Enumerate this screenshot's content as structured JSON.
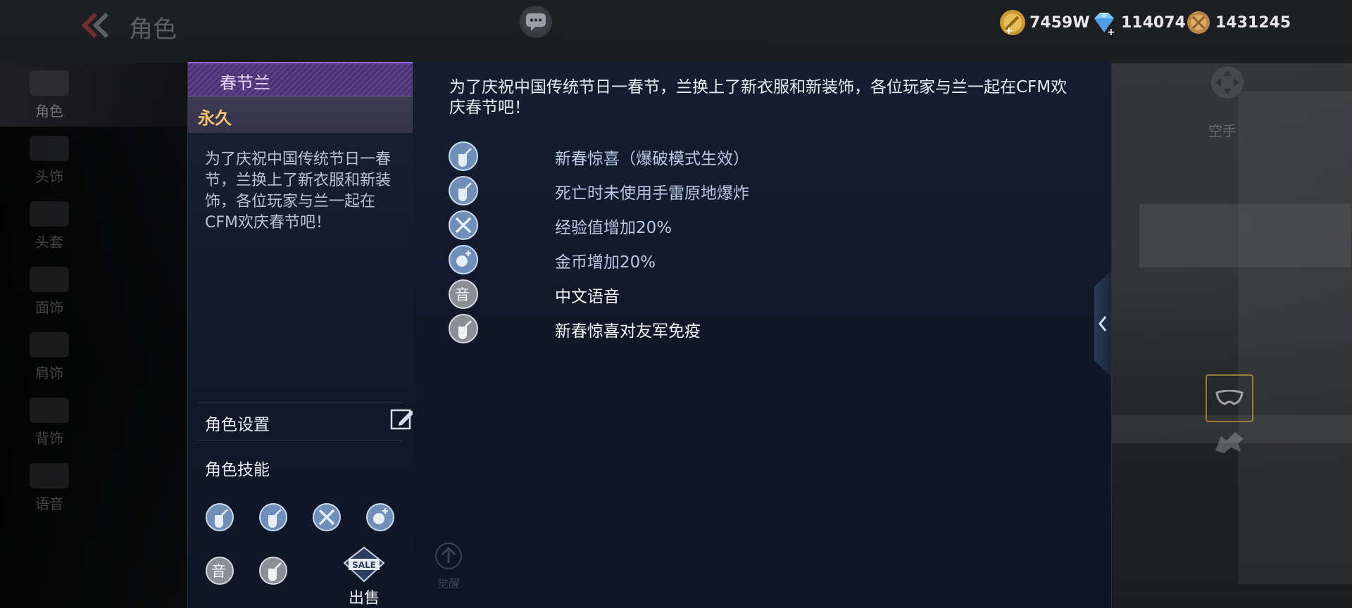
{
  "topbar": {
    "title": "角色",
    "currencies": [
      {
        "name": "gold",
        "value": "7459W",
        "color": "#e0b24a"
      },
      {
        "name": "diamond",
        "value": "114074",
        "color": "#7fc7ff"
      },
      {
        "name": "coin",
        "value": "1431245",
        "color": "#d4a857"
      }
    ]
  },
  "nav": {
    "items": [
      {
        "label": "角色",
        "active": true
      },
      {
        "label": "头饰"
      },
      {
        "label": "头套"
      },
      {
        "label": "面饰"
      },
      {
        "label": "肩饰"
      },
      {
        "label": "背饰"
      },
      {
        "label": "语音"
      }
    ]
  },
  "character": {
    "name": "春节兰",
    "duration": "永久",
    "description": "为了庆祝中国传统节日一春节，兰换上了新衣服和新装饰，各位玩家与兰一起在CFM欢庆春节吧！",
    "settings_label": "角色设置",
    "skills_label": "角色技能",
    "sell_badge": "SALE",
    "sell_label": "出售",
    "upgrade_label": "觉醒"
  },
  "detail": {
    "description": "为了庆祝中国传统节日一春节，兰换上了新衣服和新装饰，各位玩家与兰一起在CFM欢庆春节吧！",
    "attributes": [
      {
        "text": "新春惊喜（爆破模式生效）",
        "icon": "grenade-icon",
        "style": "blue"
      },
      {
        "text": "死亡时未使用手雷原地爆炸",
        "icon": "grenade-icon",
        "style": "blue"
      },
      {
        "text": "经验值增加20%",
        "icon": "exp-boost-icon",
        "style": "blue"
      },
      {
        "text": "金币增加20%",
        "icon": "coin-boost-icon",
        "style": "blue"
      },
      {
        "text": "中文语音",
        "icon": "voice-icon",
        "style": "white"
      },
      {
        "text": "新春惊喜对友军免疫",
        "icon": "grenade-gray-icon",
        "style": "white"
      }
    ]
  },
  "right_side": {
    "hand_label": "空手"
  }
}
